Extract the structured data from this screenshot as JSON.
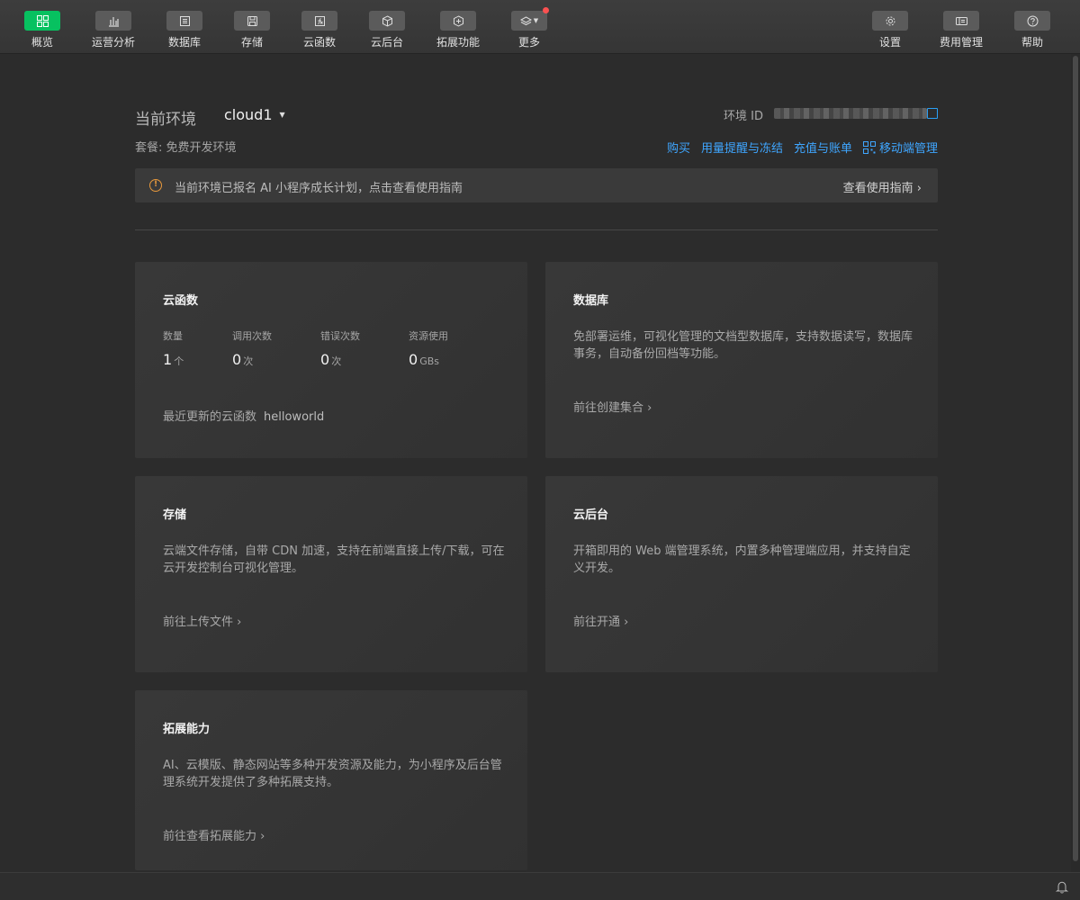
{
  "toolbar": {
    "items": [
      {
        "label": "概览",
        "icon": "overview-icon",
        "active": true
      },
      {
        "label": "运营分析",
        "icon": "bar-chart-icon"
      },
      {
        "label": "数据库",
        "icon": "database-icon"
      },
      {
        "label": "存储",
        "icon": "storage-icon"
      },
      {
        "label": "云函数",
        "icon": "function-icon"
      },
      {
        "label": "云后台",
        "icon": "cube-icon"
      },
      {
        "label": "拓展功能",
        "icon": "extension-icon"
      },
      {
        "label": "更多",
        "icon": "layers-icon",
        "badge": true
      }
    ],
    "right_items": [
      {
        "label": "设置",
        "icon": "gear-icon"
      },
      {
        "label": "费用管理",
        "icon": "billing-icon"
      },
      {
        "label": "帮助",
        "icon": "help-icon"
      }
    ],
    "accent": "#07c160"
  },
  "env": {
    "label": "当前环境",
    "name": "cloud1",
    "id_label": "环境 ID",
    "plan": "套餐: 免费开发环境",
    "links": [
      "购买",
      "用量提醒与冻结",
      "充值与账单",
      "移动端管理"
    ]
  },
  "notice": {
    "text": "当前环境已报名 AI 小程序成长计划，点击查看使用指南",
    "link": "查看使用指南 ›"
  },
  "cards": {
    "functions": {
      "title": "云函数",
      "stats": [
        {
          "label": "数量",
          "value": "1",
          "unit": "个"
        },
        {
          "label": "调用次数",
          "value": "0",
          "unit": "次"
        },
        {
          "label": "错误次数",
          "value": "0",
          "unit": "次"
        },
        {
          "label": "资源使用",
          "value": "0",
          "unit": "GBs"
        }
      ],
      "recent_label": "最近更新的云函数",
      "recent_name": "helloworld"
    },
    "database": {
      "title": "数据库",
      "desc": "免部署运维，可视化管理的文档型数据库，支持数据读写，数据库事务，自动备份回档等功能。",
      "link": "前往创建集合 ›"
    },
    "storage": {
      "title": "存储",
      "desc": "云端文件存储，自带 CDN 加速，支持在前端直接上传/下载，可在云开发控制台可视化管理。",
      "link": "前往上传文件 ›"
    },
    "backend": {
      "title": "云后台",
      "desc": "开箱即用的 Web 端管理系统，内置多种管理端应用，并支持自定义开发。",
      "link": "前往开通 ›"
    },
    "extensions": {
      "title": "拓展能力",
      "desc": "AI、云模版、静态网站等多种开发资源及能力，为小程序及后台管理系统开发提供了多种拓展支持。",
      "link": "前往查看拓展能力 ›"
    }
  },
  "colors": {
    "link": "#3fa6ff",
    "warning": "#e8993c",
    "badge": "#fa5151"
  }
}
